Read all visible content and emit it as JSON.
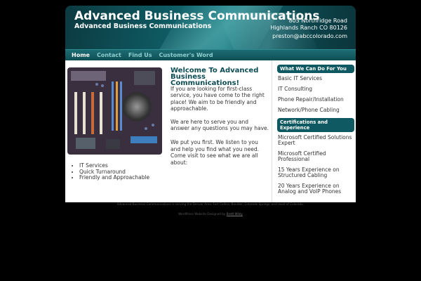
{
  "header": {
    "title": "Advanced Business Communications",
    "tagline": "Advanced Business Communications",
    "address_line1": "805 Northridge Road",
    "address_line2": "Highlands Ranch CO 80126",
    "email": "preston@abccolorado.com"
  },
  "nav": {
    "items": [
      {
        "label": "Home"
      },
      {
        "label": "Contact"
      },
      {
        "label": "Find Us"
      },
      {
        "label": "Customer's Word"
      }
    ]
  },
  "main": {
    "welcome_title": "Welcome To Advanced Business Communications!",
    "paragraphs": [
      "If you are looking for first-class service, you have come to the right place! We aim to be friendly and approachable.",
      "We are here to serve you and answer any questions you may have.",
      "We put you first. We listen to you and help you find what you need. Come visit to see what we are all about:"
    ],
    "bullets": [
      "IT Services",
      "Quick Turnaround",
      "Friendly and Approachable"
    ]
  },
  "sidebar": {
    "section1_title": "What We Can Do For You",
    "section1_items": [
      "Basic IT Services",
      "IT Consulting",
      "Phone Repair/Installation",
      "Network/Phone Cabling"
    ],
    "section2_title": "Certifications and Experience",
    "section2_items": [
      "Microsoft Certified Solutions Expert",
      "Microsoft Certified Professional",
      "15 Years Experience on Structured Cabling",
      "20 Years Experience on Analog and VoIP Phones"
    ]
  },
  "footer": {
    "line1": "Advanced Business Communications is serving the Denver Area, Fort Collins, Boulder, Colorado Springs, and most of Colorado.",
    "line2_prefix": "WordPress Website Designed by",
    "line2_link": "Brett Wiley"
  },
  "colors": {
    "accent": "#0f5a62",
    "nav_active": "#ffffff",
    "nav_inactive": "#8fd0d0"
  }
}
